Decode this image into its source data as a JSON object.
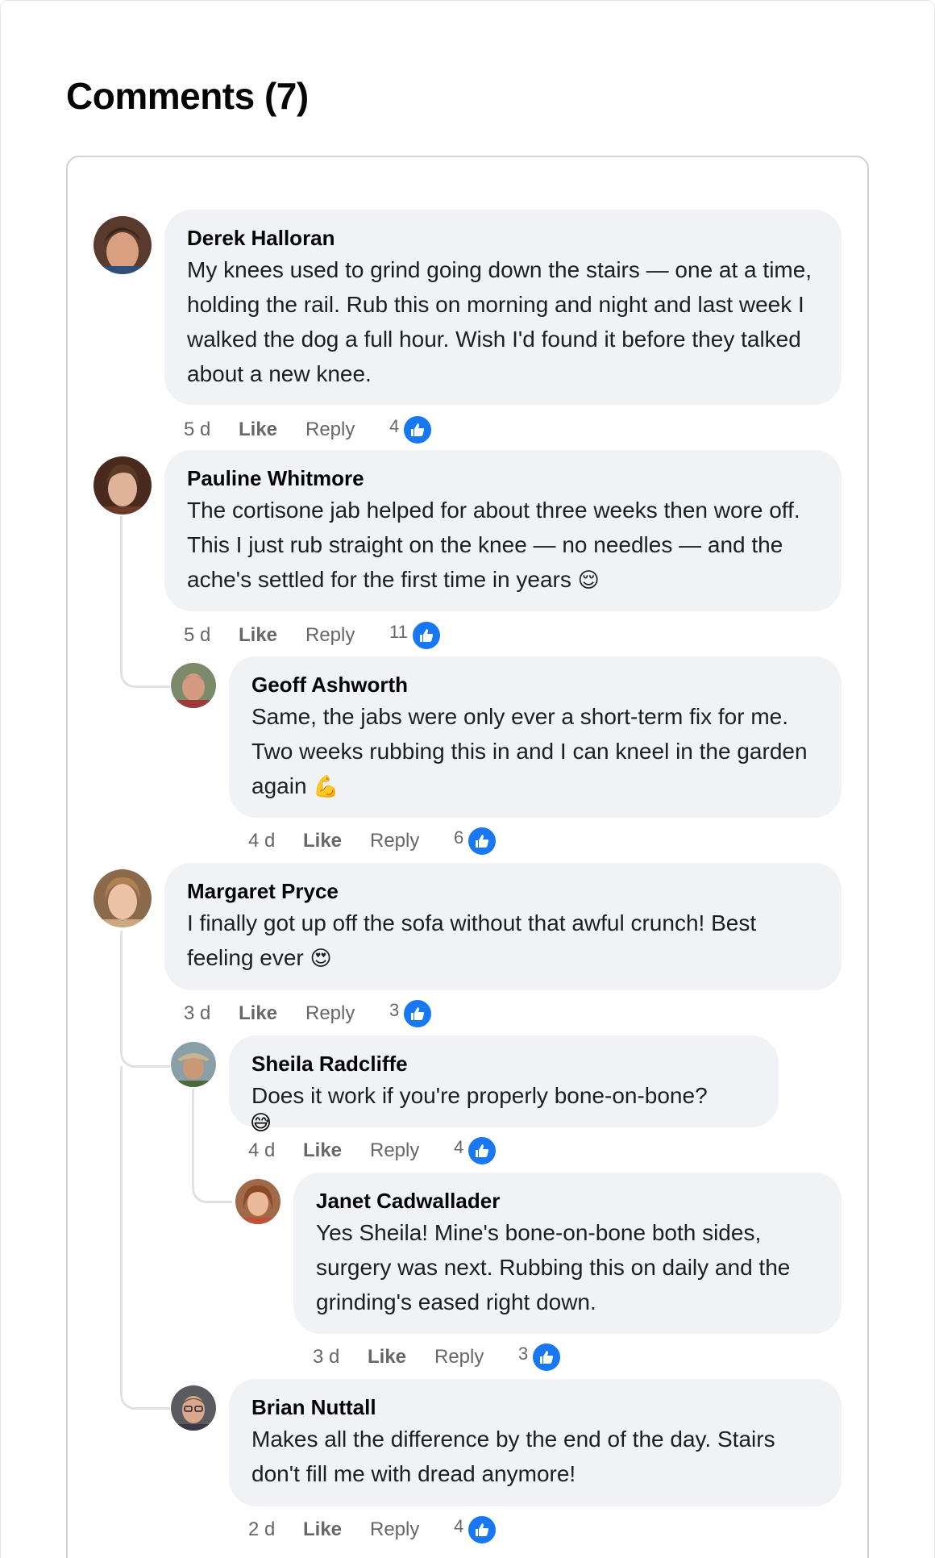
{
  "heading": "Comments (7)",
  "comments": [
    {
      "author": "Derek Halloran",
      "text": "My knees used to grind going down the stairs — one at a time, holding the rail. Rub this on morning and night and last week I walked the dog a full hour. Wish I'd found it before they talked about a new knee.",
      "time": "5 d",
      "like": "Like",
      "reply": "Reply",
      "likes": "4"
    },
    {
      "author": "Pauline Whitmore",
      "text": "The cortisone jab helped for about three weeks then wore off. This I just rub straight on the knee — no needles — and the ache's settled for the first time in years",
      "emoji": "😌",
      "time": "5 d",
      "like": "Like",
      "reply": "Reply",
      "likes": "11"
    },
    {
      "author": "Geoff Ashworth",
      "text": "Same, the jabs were only ever a short-term fix for me. Two weeks rubbing this in and I can kneel in the garden again",
      "emoji": "💪",
      "time": "4 d",
      "like": "Like",
      "reply": "Reply",
      "likes": "6"
    },
    {
      "author": "Margaret Pryce",
      "text": "I finally got up off the sofa without that awful crunch! Best feeling ever",
      "emoji": "😍",
      "time": "3 d",
      "like": "Like",
      "reply": "Reply",
      "likes": "3"
    },
    {
      "author": "Sheila Radcliffe",
      "text": "Does it work if you're properly bone-on-bone?",
      "emoji": "😅",
      "time": "4 d",
      "like": "Like",
      "reply": "Reply",
      "likes": "4"
    },
    {
      "author": "Janet Cadwallader",
      "text": "Yes Sheila! Mine's bone-on-bone both sides, surgery was next. Rubbing this on daily and the grinding's eased right down.",
      "time": "3 d",
      "like": "Like",
      "reply": "Reply",
      "likes": "3"
    },
    {
      "author": "Brian Nuttall",
      "text": "Makes all the difference by the end of the day. Stairs don't fill me with dread anymore!",
      "time": "2 d",
      "like": "Like",
      "reply": "Reply",
      "likes": "4"
    }
  ],
  "icons": {
    "like": "thumbs-up-icon"
  },
  "colors": {
    "accent": "#1877f2",
    "bubble": "#f0f2f5",
    "meta": "#65676b"
  }
}
